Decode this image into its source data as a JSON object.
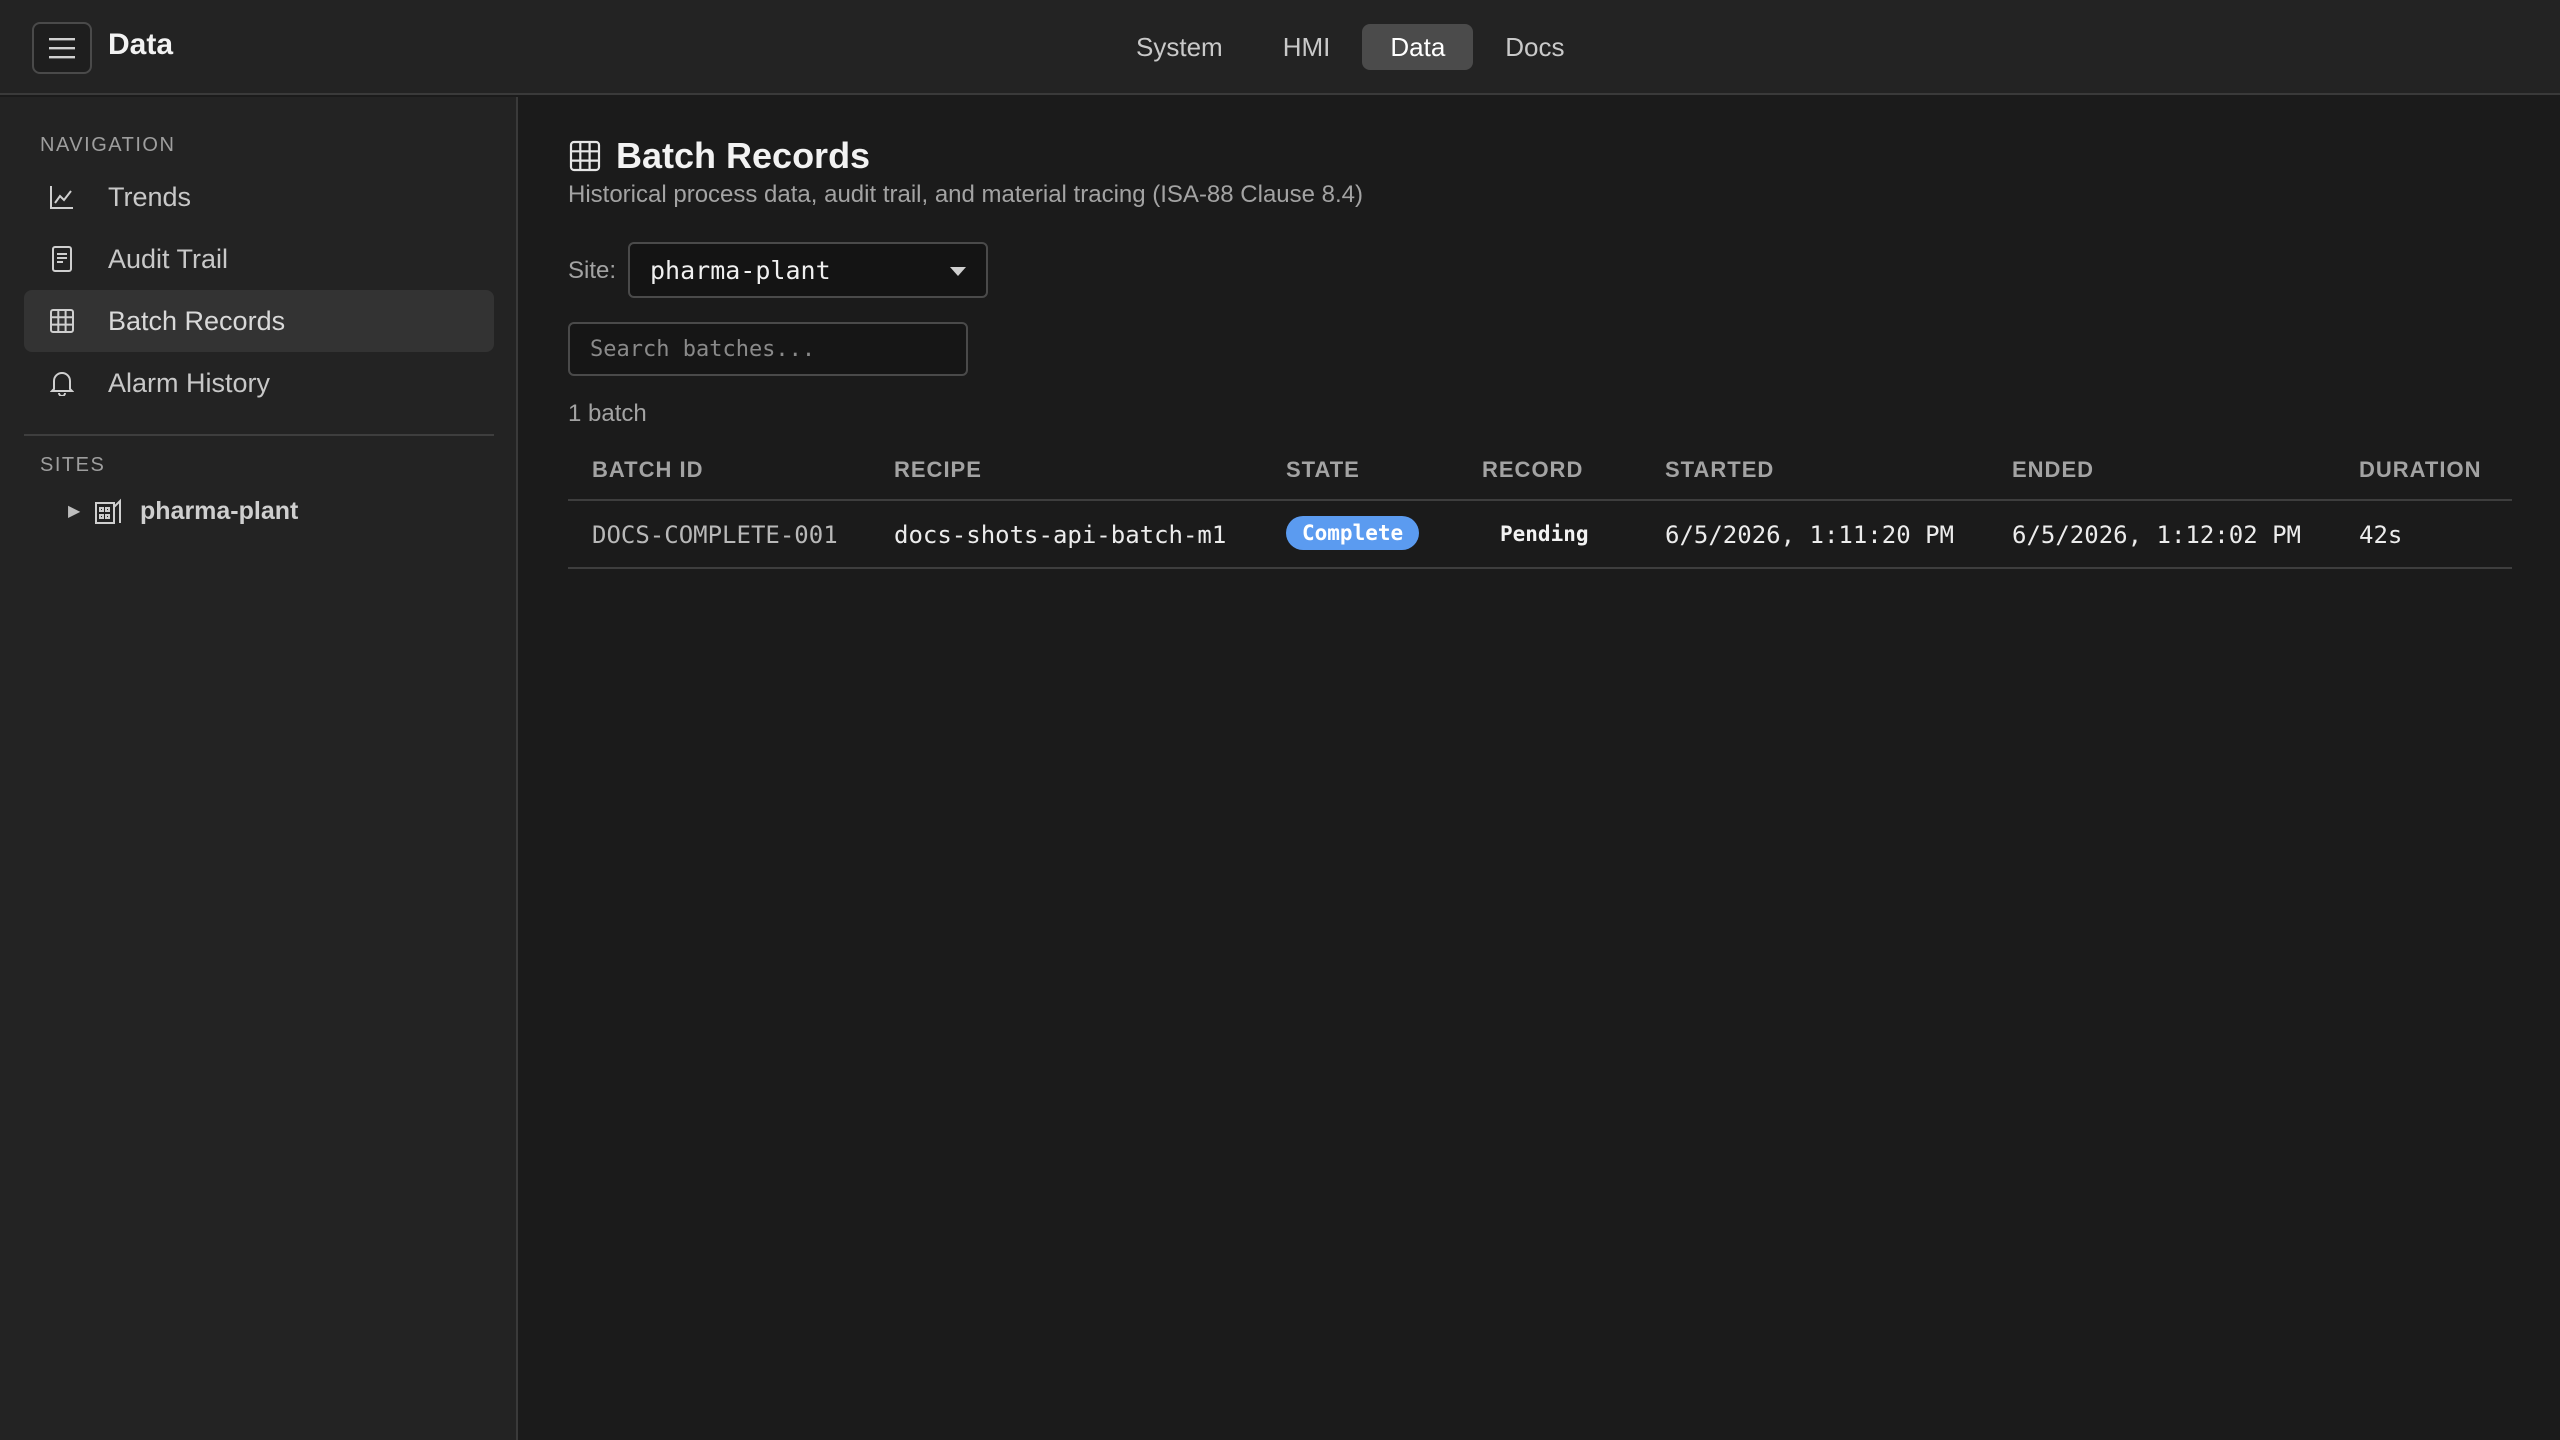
{
  "header": {
    "title": "Data",
    "tabs": [
      {
        "label": "System"
      },
      {
        "label": "HMI"
      },
      {
        "label": "Data"
      },
      {
        "label": "Docs"
      }
    ]
  },
  "sidebar": {
    "nav_heading": "NAVIGATION",
    "items": [
      {
        "label": "Trends",
        "icon": "chart-line-icon"
      },
      {
        "label": "Audit Trail",
        "icon": "document-icon"
      },
      {
        "label": "Batch Records",
        "icon": "grid-icon"
      },
      {
        "label": "Alarm History",
        "icon": "bell-icon"
      }
    ],
    "sites_heading": "SITES",
    "sites": [
      {
        "name": "pharma-plant",
        "icon": "building-icon"
      }
    ]
  },
  "main": {
    "title": "Batch Records",
    "subtitle": "Historical process data, audit trail, and material tracing (ISA-88 Clause 8.4)",
    "site_label": "Site:",
    "site_value": "pharma-plant",
    "search_placeholder": "Search batches...",
    "count_text": "1 batch",
    "table": {
      "columns": [
        "BATCH ID",
        "RECIPE",
        "STATE",
        "RECORD",
        "STARTED",
        "ENDED",
        "DURATION"
      ],
      "rows": [
        {
          "batch_id": "DOCS-COMPLETE-001",
          "recipe": "docs-shots-api-batch-m1",
          "state": "Complete",
          "record": "Pending",
          "started": "6/5/2026, 1:11:20 PM",
          "ended": "6/5/2026, 1:12:02 PM",
          "duration": "42s"
        }
      ]
    }
  },
  "colors": {
    "accent": "#5b9bf0",
    "background": "#1b1b1b",
    "panel": "#232323"
  }
}
